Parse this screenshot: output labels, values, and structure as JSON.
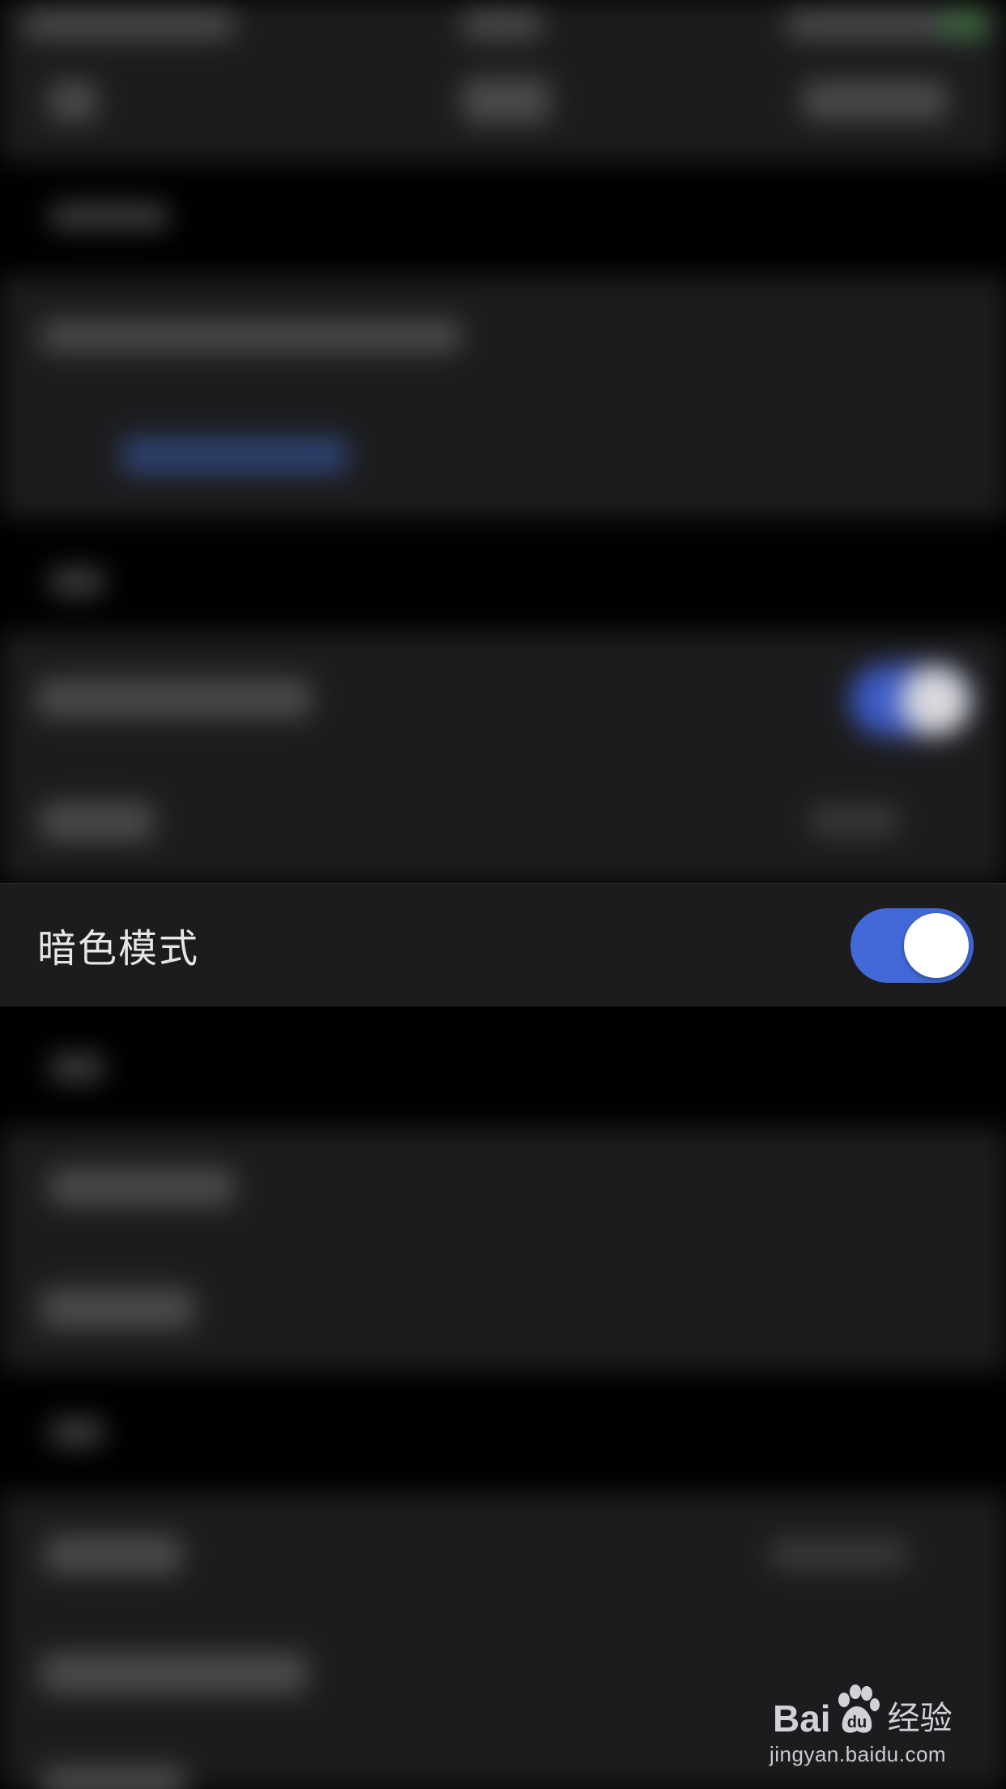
{
  "setting_row": {
    "label": "暗色模式",
    "toggle_on": true
  },
  "watermark": {
    "logo_left": "Bai",
    "logo_right": "",
    "logo_cn": "经验",
    "url": "jingyan.baidu.com"
  },
  "colors": {
    "background": "#000000",
    "group_background": "#1c1c1e",
    "toggle_on": "#4369d9",
    "knob": "#ffffff",
    "label_text": "#e6e6e8"
  },
  "icons": {
    "paw": "baidu-paw-icon"
  }
}
